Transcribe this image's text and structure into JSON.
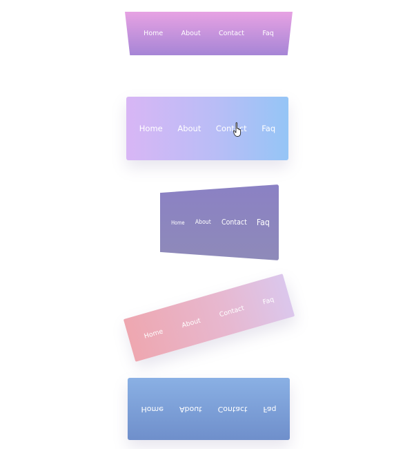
{
  "menus": [
    {
      "items": [
        {
          "label": "Home"
        },
        {
          "label": "About"
        },
        {
          "label": "Contact"
        },
        {
          "label": "Faq"
        }
      ]
    },
    {
      "items": [
        {
          "label": "Home"
        },
        {
          "label": "About"
        },
        {
          "label": "Contact"
        },
        {
          "label": "Faq"
        }
      ]
    },
    {
      "items": [
        {
          "label": "Home"
        },
        {
          "label": "About"
        },
        {
          "label": "Contact"
        },
        {
          "label": "Faq"
        }
      ]
    },
    {
      "items": [
        {
          "label": "Home"
        },
        {
          "label": "About"
        },
        {
          "label": "Contact"
        },
        {
          "label": "Faq"
        }
      ]
    },
    {
      "items": [
        {
          "label": "Home"
        },
        {
          "label": "About"
        },
        {
          "label": "Contact"
        },
        {
          "label": "Faq"
        }
      ]
    }
  ],
  "colors": {
    "menu1": [
      "#e7a2e3",
      "#a685d6"
    ],
    "menu2": [
      "#d8b6f5",
      "#95c5f6"
    ],
    "menu3": [
      "#8b81c4",
      "#8e8ab9"
    ],
    "menu4": [
      "#eea7b0",
      "#dbc7ec"
    ],
    "menu5": [
      "#8ab0e4",
      "#6f8fcb"
    ]
  },
  "cursor": {
    "icon": "hand-pointer-icon"
  }
}
